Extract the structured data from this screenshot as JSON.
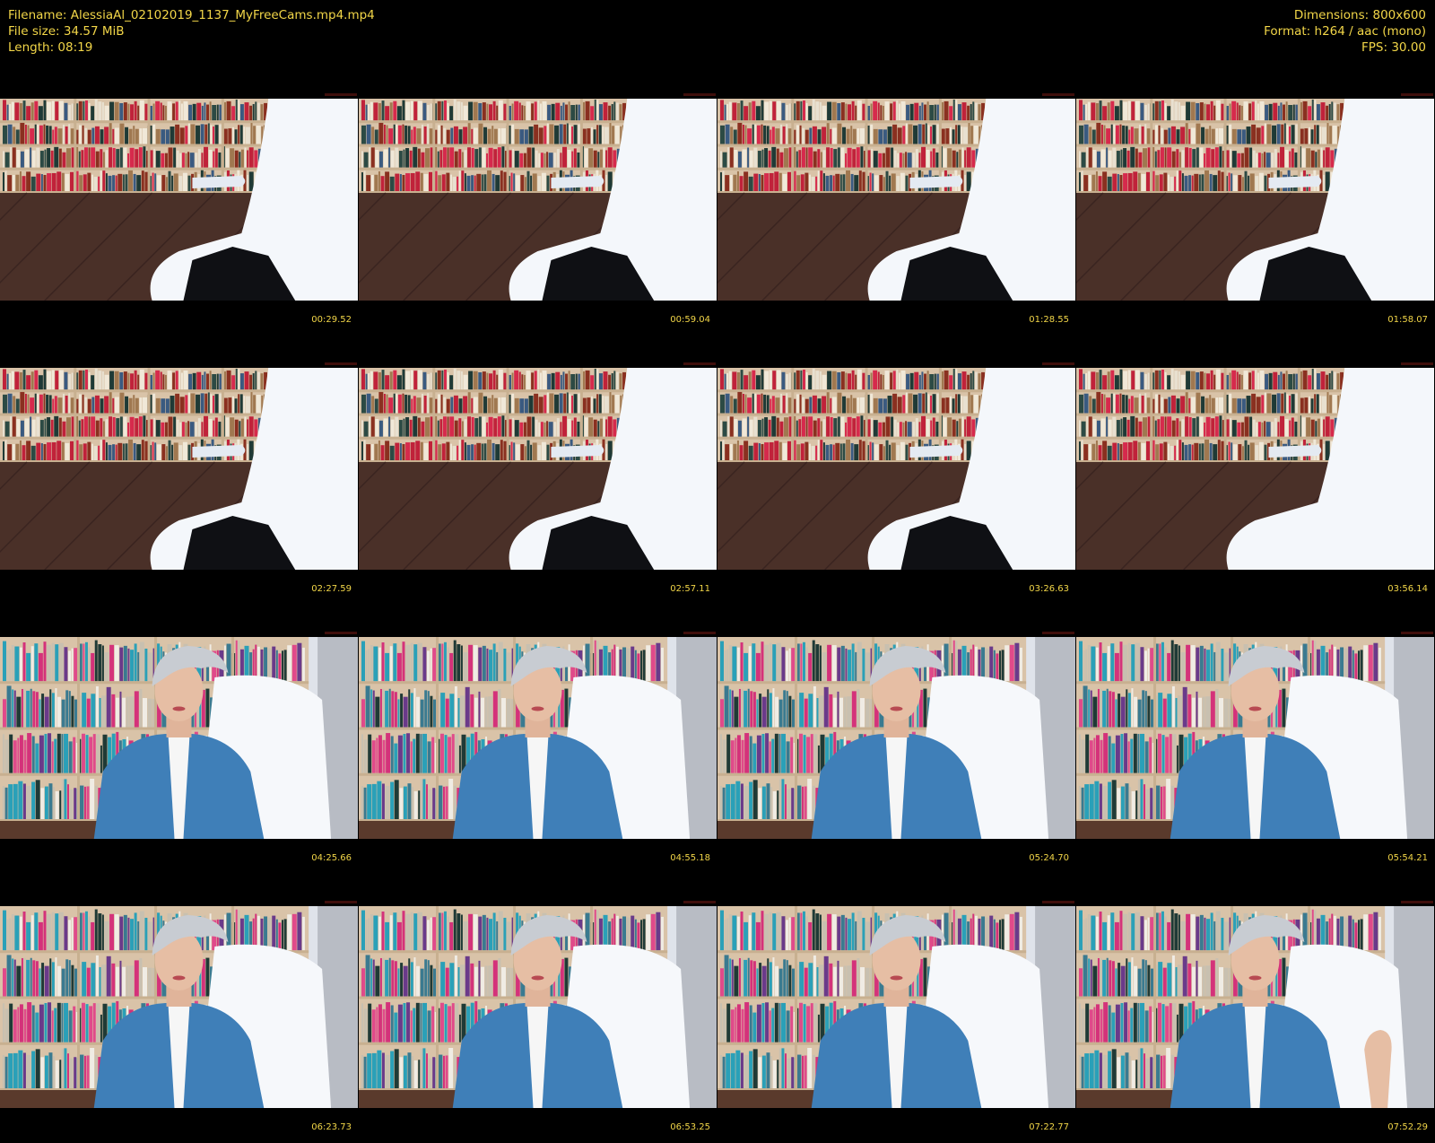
{
  "header": {
    "filename_line": "Filename: AlessiaAl_02102019_1137_MyFreeCams.mp4.mp4",
    "filesize_line": "File size: 34.57 MiB",
    "length_line": "Length: 08:19",
    "dimensions_line": "Dimensions: 800x600",
    "format_line": "Format: h264 / aac (mono)",
    "fps_line": "FPS: 30.00"
  },
  "colors": {
    "text": "#f2d648",
    "background": "#000000"
  },
  "thumbnails": [
    {
      "time": "00:29.52",
      "scene": "empty-room"
    },
    {
      "time": "00:59.04",
      "scene": "empty-room"
    },
    {
      "time": "01:28.55",
      "scene": "empty-room"
    },
    {
      "time": "01:58.07",
      "scene": "empty-room"
    },
    {
      "time": "02:27.59",
      "scene": "empty-room"
    },
    {
      "time": "02:57.11",
      "scene": "empty-room"
    },
    {
      "time": "03:26.63",
      "scene": "empty-room"
    },
    {
      "time": "03:56.14",
      "scene": "empty-room-no-cloth"
    },
    {
      "time": "04:25.66",
      "scene": "person"
    },
    {
      "time": "04:55.18",
      "scene": "person"
    },
    {
      "time": "05:24.70",
      "scene": "person"
    },
    {
      "time": "05:54.21",
      "scene": "person"
    },
    {
      "time": "06:23.73",
      "scene": "person"
    },
    {
      "time": "06:53.25",
      "scene": "person"
    },
    {
      "time": "07:22.77",
      "scene": "person"
    },
    {
      "time": "07:52.29",
      "scene": "person-hand"
    }
  ]
}
